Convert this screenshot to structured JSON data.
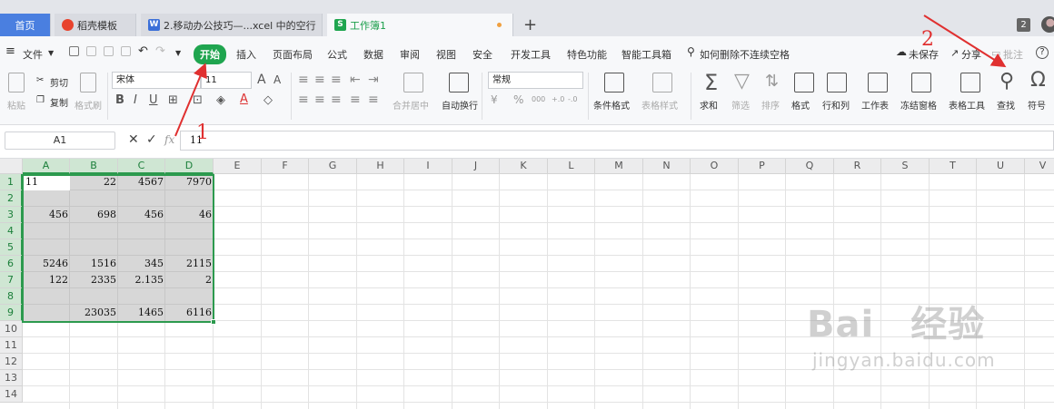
{
  "tabs": {
    "home": "首页",
    "items": [
      "稻壳模板",
      "2.移动办公技巧—...xcel 中的空行",
      "工作簿1"
    ],
    "window_count": "2"
  },
  "menu": {
    "file": "文件",
    "items": [
      "开始",
      "插入",
      "页面布局",
      "公式",
      "数据",
      "审阅",
      "视图",
      "安全",
      "开发工具",
      "特色功能",
      "智能工具箱"
    ],
    "search": "如何删除不连续空格",
    "unsaved": "未保存",
    "share": "分享",
    "comment": "批注"
  },
  "ribbon": {
    "paste": "粘贴",
    "cut": "剪切",
    "copy": "复制",
    "format_painter": "格式刷",
    "font_name": "宋体",
    "font_size": "11",
    "merge_center": "合并居中",
    "wrap_text": "自动换行",
    "number_format": "常规",
    "conditional_format": "条件格式",
    "table_style": "表格样式",
    "sum": "求和",
    "filter": "筛选",
    "sort": "排序",
    "format": "格式",
    "row_col": "行和列",
    "worksheet": "工作表",
    "freeze": "冻结窗格",
    "table_tools": "表格工具",
    "find": "查找",
    "symbol": "符号"
  },
  "formula_bar": {
    "cell_ref": "A1",
    "fx": "fx",
    "value": "11"
  },
  "columns": [
    "A",
    "B",
    "C",
    "D",
    "E",
    "F",
    "G",
    "H",
    "I",
    "J",
    "K",
    "L",
    "M",
    "N",
    "O",
    "P",
    "Q",
    "R",
    "S",
    "T",
    "U",
    "V"
  ],
  "rows": [
    "1",
    "2",
    "3",
    "4",
    "5",
    "6",
    "7",
    "8",
    "9",
    "10",
    "11",
    "12",
    "13",
    "14"
  ],
  "cells": {
    "r1": [
      "11",
      "22",
      "4567",
      "7970"
    ],
    "r3": [
      "456",
      "698",
      "456",
      "46"
    ],
    "r6": [
      "5246",
      "1516",
      "345",
      "2115"
    ],
    "r7": [
      "122",
      "2335",
      "2.135",
      "2"
    ],
    "r9": [
      "",
      "23035",
      "1465",
      "6116"
    ]
  },
  "annotations": [
    "1",
    "2"
  ],
  "watermark": {
    "brand": "Bai",
    "brand2": "经验",
    "url": "jingyan.baidu.com"
  },
  "colors": {
    "accent_green": "#1fa54f",
    "home_tab": "#4a7fe0",
    "annotation_red": "#e03030",
    "selection": "#2c9a4e"
  }
}
